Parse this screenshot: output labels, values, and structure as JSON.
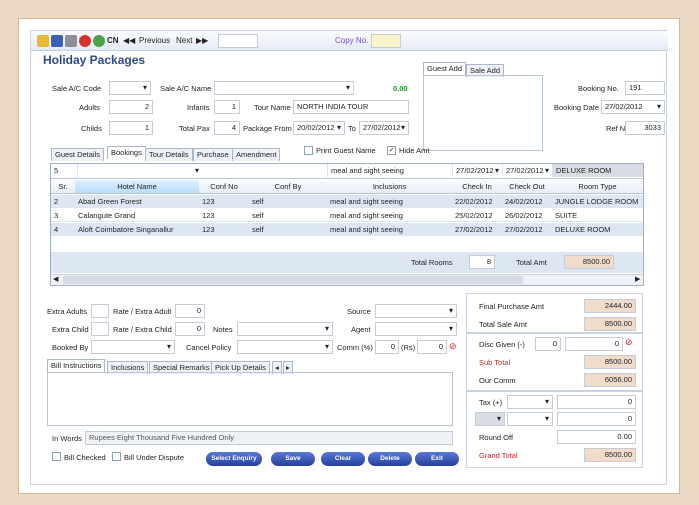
{
  "toolbar": {
    "cn": "CN",
    "previous": "Previous",
    "next": "Next",
    "copy_no": "Copy No."
  },
  "title": "Holiday Packages",
  "header": {
    "sale_ac_code_label": "Sale A/C Code",
    "sale_ac_name_label": "Sale A/C Name",
    "balance": "0.00",
    "adults_label": "Adults",
    "adults": "2",
    "infants_label": "Infants",
    "infants": "1",
    "tour_name_label": "Tour Name",
    "tour_name": "NORTH INDIA TOUR",
    "childs_label": "Childs",
    "childs": "1",
    "total_pax_label": "Total Pax",
    "total_pax": "4",
    "package_from_label": "Package From",
    "package_from": "20/02/2012",
    "to_label": "To",
    "package_to": "27/02/2012"
  },
  "guest_tabs": [
    "Guest Add",
    "Sale Add"
  ],
  "booking": {
    "booking_no_label": "Booking No.",
    "booking_no": "191",
    "booking_date_label": "Booking Date",
    "booking_date": "27/02/2012",
    "ref_no_label": "Ref No",
    "ref_no": "3033"
  },
  "tabs": [
    "Guest Details",
    "Bookings",
    "Tour Details",
    "Purchase",
    "Amendment"
  ],
  "print_guest_name": "Print Guest Name",
  "hide_amt": "Hide Amt",
  "entry_row": {
    "sr": "5",
    "inclusions": "meal and sight seeing",
    "check_in": "27/02/2012",
    "check_out": "27/02/2012",
    "room_type": "DELUXE ROOM"
  },
  "columns": [
    "Sr.",
    "Hotel Name",
    "Conf No",
    "Conf By",
    "Inclusions",
    "Check In",
    "Check Out",
    "Room Type"
  ],
  "rows": [
    [
      "2",
      "Abad Green Forest",
      "123",
      "self",
      "meal and sight seeing",
      "22/02/2012",
      "24/02/2012",
      "JUNGLE LODGE ROOM"
    ],
    [
      "3",
      "Calangute Grand",
      "123",
      "self",
      "meal and sight seeing",
      "25/02/2012",
      "26/02/2012",
      "SUITE"
    ],
    [
      "4",
      "Aloft Coimbatore Singanallur",
      "123",
      "self",
      "meal and sight seeing",
      "27/02/2012",
      "27/02/2012",
      "DELUXE ROOM"
    ]
  ],
  "totals": {
    "total_rooms_label": "Total Rooms",
    "total_rooms": "8",
    "total_amt_label": "Total Amt",
    "total_amt": "8500.00"
  },
  "extras": {
    "extra_adults_label": "Extra Adults",
    "rate_extra_adult_label": "Rate / Extra Adult",
    "rate_extra_adult": "0",
    "extra_child_label": "Extra Child",
    "rate_extra_child_label": "Rate / Extra Child",
    "rate_extra_child": "0",
    "notes_label": "Notes",
    "booked_by_label": "Booked By",
    "cancel_policy_label": "Cancel Policy",
    "source_label": "Source",
    "agent_label": "Agent",
    "comm_label": "Comm (%)",
    "comm": "0",
    "rs_label": "(Rs)",
    "rs": "0"
  },
  "bottom_tabs": [
    "Bill Instructions",
    "Inclusions",
    "Special Remarks",
    "Pick Up Details"
  ],
  "summary": {
    "final_purchase_label": "Final Purchase Amt",
    "final_purchase": "2444.00",
    "total_sale_label": "Total Sale Amt",
    "total_sale": "8500.00",
    "disc_label": "Disc Given (-)",
    "disc_pct": "0",
    "disc_amt": "0",
    "sub_total_label": "Sub Total",
    "sub_total": "8500.00",
    "our_comm_label": "Our Comm",
    "our_comm": "6056.00",
    "tax_label": "Tax (+)",
    "tax1": "0",
    "tax2": "0",
    "round_off_label": "Round Off",
    "round_off": "0.00",
    "grand_total_label": "Grand Total",
    "grand_total": "8500.00"
  },
  "in_words_label": "In Words",
  "in_words": "Rupees Eight Thousand Five Hundred Only",
  "bill_checked": "Bill Checked",
  "bill_dispute": "Bill Under Dispute",
  "buttons": {
    "select_enquiry": "Select Enquiry",
    "save": "Save",
    "clear": "Clear",
    "delete": "Delete",
    "exit": "Exit"
  }
}
